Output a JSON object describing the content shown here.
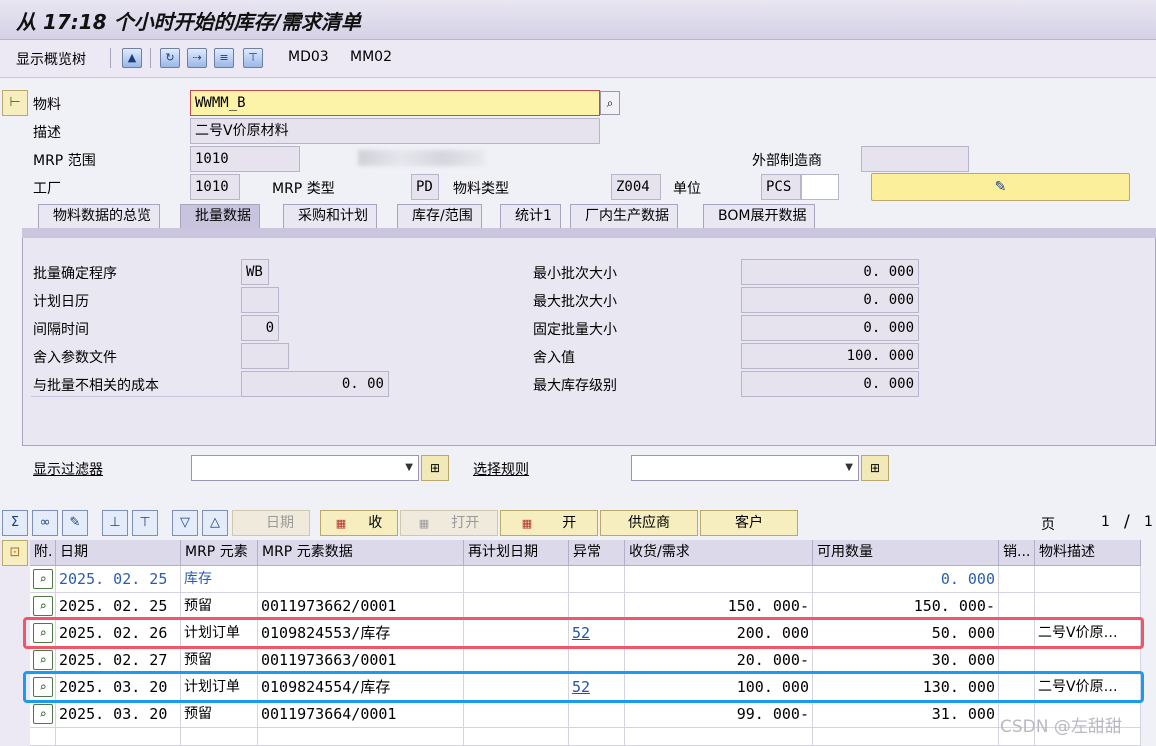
{
  "title": "从 17:18 个小时开始的库存/需求清单",
  "toolbar": {
    "overview_tree": "显示概览树",
    "icons": [
      "mountain-icon",
      "refresh-icon",
      "next-material-icon",
      "details-icon",
      "pegging-icon"
    ],
    "md03": "MD03",
    "mm02": "MM02"
  },
  "header": {
    "material_label": "物料",
    "material_value": "WWMM_B",
    "desc_label": "描述",
    "desc_value": "二号V价原材料",
    "mrp_area_label": "MRP 范围",
    "mrp_area_value": "1010",
    "ext_mfr_label": "外部制造商",
    "plant_label": "工厂",
    "plant_value": "1010",
    "mrp_type_label": "MRP 类型",
    "mrp_type_value": "PD",
    "mat_type_label": "物料类型",
    "mat_type_value": "Z004",
    "unit_label": "单位",
    "unit_value": "PCS"
  },
  "tabs": [
    "物料数据的总览",
    "批量数据",
    "采购和计划",
    "库存/范围",
    "统计1",
    "厂内生产数据",
    "BOM展开数据"
  ],
  "lot": {
    "lot_proc_label": "批量确定程序",
    "lot_proc_value": "WB",
    "calendar_label": "计划日历",
    "interval_label": "间隔时间",
    "interval_value": "0",
    "rounding_profile_label": "舍入参数文件",
    "lot_indep_cost_label": "与批量不相关的成本",
    "lot_indep_cost_value": "0. 00",
    "min_lot_label": "最小批次大小",
    "min_lot_value": "0. 000",
    "max_lot_label": "最大批次大小",
    "max_lot_value": "0. 000",
    "fixed_lot_label": "固定批量大小",
    "fixed_lot_value": "0. 000",
    "rounding_value_label": "舍入值",
    "rounding_value": "100. 000",
    "max_stock_label": "最大库存级别",
    "max_stock_value": "0. 000"
  },
  "filters": {
    "filter_label": "显示过滤器",
    "selection_label": "选择规则"
  },
  "grid_toolbar": {
    "date_btn": "日期",
    "receipt_btn": "收",
    "open_btn": "打开",
    "open2_btn": "开",
    "vendor_btn": "供应商",
    "customer_btn": "客户",
    "page_label": "页",
    "page_current": "1",
    "page_sep": "/",
    "page_total": "1"
  },
  "grid": {
    "columns": [
      "附.",
      "日期",
      "MRP 元素",
      "MRP 元素数据",
      "再计划日期",
      "异常",
      "收货/需求",
      "可用数量",
      "销...",
      "物料描述"
    ],
    "rows": [
      {
        "date": "2025. 02. 25",
        "element": "库存",
        "data": "",
        "resched": "",
        "exception": "",
        "qty": "",
        "avail": "0. 000",
        "so": "",
        "desc": "",
        "stock": true
      },
      {
        "date": "2025. 02. 25",
        "element": "预留",
        "data": "0011973662/0001",
        "resched": "",
        "exception": "",
        "qty": "150. 000-",
        "avail": "150. 000-",
        "so": "",
        "desc": ""
      },
      {
        "date": "2025. 02. 26",
        "element": "计划订单",
        "data": "0109824553/库存",
        "resched": "",
        "exception": "52",
        "qty": "200. 000",
        "avail": "50. 000",
        "so": "",
        "desc": "二号V价原…"
      },
      {
        "date": "2025. 02. 27",
        "element": "预留",
        "data": "0011973663/0001",
        "resched": "",
        "exception": "",
        "qty": "20. 000-",
        "avail": "30. 000",
        "so": "",
        "desc": ""
      },
      {
        "date": "2025. 03. 20",
        "element": "计划订单",
        "data": "0109824554/库存",
        "resched": "",
        "exception": "52",
        "qty": "100. 000",
        "avail": "130. 000",
        "so": "",
        "desc": "二号V价原…"
      },
      {
        "date": "2025. 03. 20",
        "element": "预留",
        "data": "0011973664/0001",
        "resched": "",
        "exception": "",
        "qty": "99. 000-",
        "avail": "31. 000",
        "so": "",
        "desc": ""
      }
    ]
  },
  "watermark": "CSDN @左甜甜"
}
